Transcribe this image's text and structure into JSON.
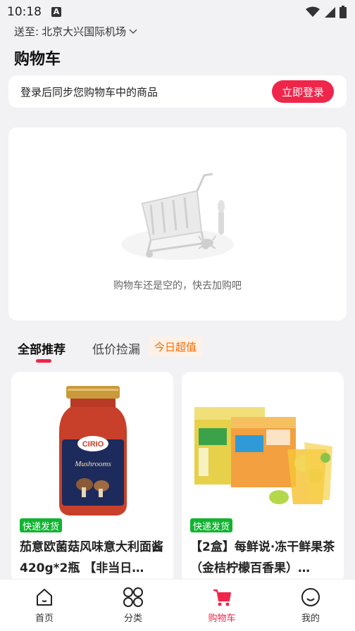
{
  "status": {
    "time": "10:18",
    "a_badge": "A"
  },
  "deliver": {
    "label": "送至:",
    "location": "北京大兴国际机场"
  },
  "page": {
    "title": "购物车"
  },
  "login": {
    "prompt": "登录后同步您购物车中的商品",
    "button": "立即登录"
  },
  "empty": {
    "message": "购物车还是空的，快去加购吧"
  },
  "tabs": [
    {
      "label": "全部推荐",
      "active": true
    },
    {
      "label": "低价捡漏",
      "active": false
    }
  ],
  "tab_badge": "今日超值",
  "products": [
    {
      "tag": "快递发货",
      "title": "茄意欧菌菇风味意大利面酱 420g*2瓶 【非当日…",
      "jar_brand": "CIRIO",
      "jar_text": "Mushrooms"
    },
    {
      "tag": "快递发货",
      "title": "【2盒】每鲜说·冻干鲜果茶（金桔柠檬百香果）…"
    }
  ],
  "nav": [
    {
      "label": "首页",
      "icon": "home-icon"
    },
    {
      "label": "分类",
      "icon": "category-icon"
    },
    {
      "label": "购物车",
      "icon": "cart-icon",
      "active": true
    },
    {
      "label": "我的",
      "icon": "profile-icon"
    }
  ],
  "colors": {
    "accent": "#f0254a",
    "ship_tag": "#11b431",
    "badge_text": "#ff6a00"
  }
}
